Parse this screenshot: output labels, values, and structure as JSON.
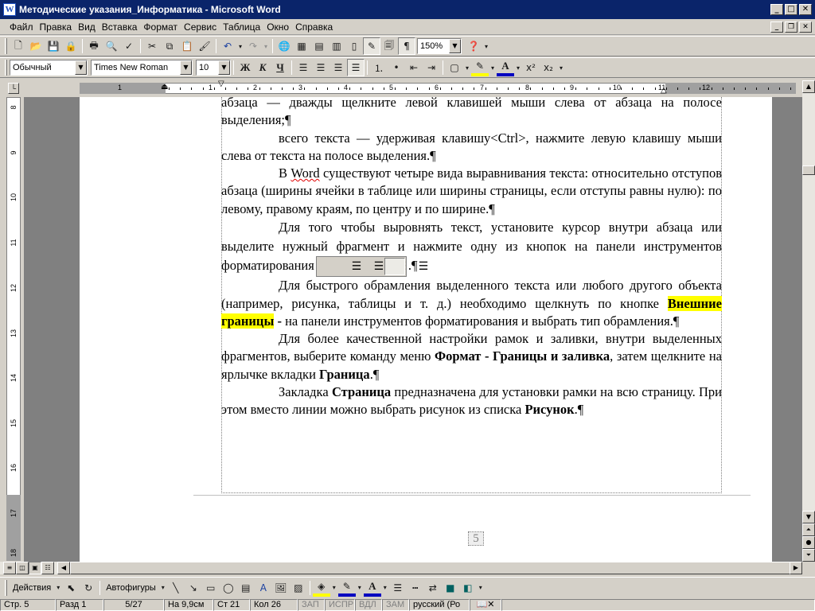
{
  "window": {
    "title": "Методические указания_Информатика - Microsoft Word",
    "app_icon": "W"
  },
  "menu": [
    "Файл",
    "Правка",
    "Вид",
    "Вставка",
    "Формат",
    "Сервис",
    "Таблица",
    "Окно",
    "Справка"
  ],
  "standard_toolbar": {
    "zoom": "150%"
  },
  "formatting_toolbar": {
    "style": "Обычный",
    "font": "Times New Roman",
    "size": "10",
    "bold": "Ж",
    "italic": "К",
    "underline": "Ч",
    "superscript": "x²",
    "subscript": "x₂"
  },
  "ruler": {
    "h_numbers": [
      "1",
      "1",
      "2",
      "3",
      "4",
      "5",
      "6",
      "7",
      "8",
      "9",
      "10",
      "11",
      "12"
    ],
    "v_numbers": [
      "8",
      "9",
      "10",
      "11",
      "12",
      "13",
      "14",
      "15",
      "16",
      "17",
      "18"
    ]
  },
  "document": {
    "p1": "абзаца — дважды щелкните левой клавишей мыши слева от абзаца на полосе выделения;¶",
    "p2": "всего текста — удерживая клавишу<Ctrl>, нажмите левую клавишу мыши слева от текста на полосе выделения.¶",
    "p3_a": "В ",
    "p3_word": "Word",
    "p3_b": " существуют четыре вида выравнивания текста: относительно отступов абзаца (ширины ячейки в таблице или ширины страницы, если отступы равны нулю): по левому, правому краям, по центру и по ширине.¶",
    "p4_a": "Для того чтобы выровнять текст, установите курсор внутри абзаца или выделите нужный фрагмент и нажмите одну из кнопок на панели инструментов форматирования",
    "p4_b": ".¶",
    "p5_a": "Для быстрого обрамления выделенного текста или любого другого объекта (например, рисунка, таблицы и т. д.) необходимо щелкнуть по кнопке ",
    "p5_hl": "Внешние границы",
    "p5_dash": " -",
    "p5_b": "  на панели инструментов форматирования и выбрать тип обрамления.¶",
    "p6_a": "Для более качественной настройки рамок и заливки, внутри выделенных фрагментов, выберите команду меню ",
    "p6_bold1": "Формат - Границы и заливка",
    "p6_b": ", затем щелкните на ярлычке вкладки ",
    "p6_bold2": "Граница",
    "p6_c": ".¶",
    "p7_a": "Закладка ",
    "p7_bold1": "Страница",
    "p7_b": " предназначена для установки рамки на всю страницу. При этом вместо линии можно выбрать рисунок из списка ",
    "p7_bold2": "Рисунок",
    "p7_c": ".¶",
    "page_number": "5"
  },
  "drawing_toolbar": {
    "actions": "Действия",
    "autoshapes": "Автофигуры"
  },
  "status": {
    "page": "Стр. 5",
    "section": "Разд 1",
    "pages": "5/27",
    "at": "На 9,9см",
    "line": "Ст 21",
    "col": "Кол 26",
    "rec": "ЗАП",
    "trk": "ИСПР",
    "ext": "ВДЛ",
    "ovr": "ЗАМ",
    "lang": "русский (Ро"
  }
}
